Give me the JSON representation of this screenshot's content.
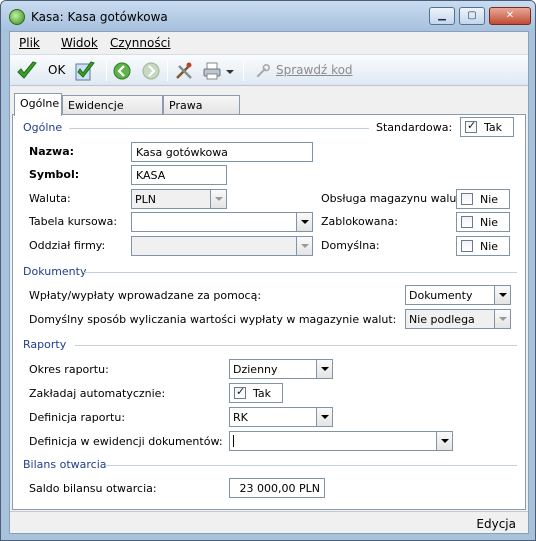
{
  "window": {
    "title": "Kasa: Kasa gotówkowa",
    "controls": {
      "minimize": "▁",
      "maximize": "▢",
      "close": "✕"
    }
  },
  "menu": {
    "items": [
      "Plik",
      "Widok",
      "Czynności"
    ]
  },
  "toolbar": {
    "ok_label": "OK",
    "check_label": "Sprawdź kod",
    "icons": [
      "ok-check-icon",
      "save-check-icon",
      "back-arrow-icon",
      "forward-arrow-icon",
      "tools-icon",
      "printer-icon",
      "dropdown-icon",
      "wrench-icon"
    ]
  },
  "tabs": [
    "Ogólne",
    "Ewidencje zależne",
    "Prawa danych"
  ],
  "general": {
    "section": "Ogólne",
    "standard_label": "Standardowa:",
    "standard_value": "Tak",
    "name_label": "Nazwa:",
    "name_value": "Kasa gotówkowa",
    "symbol_label": "Symbol:",
    "symbol_value": "KASA",
    "currency_label": "Waluta:",
    "currency_value": "PLN",
    "rate_table_label": "Tabela kursowa:",
    "rate_table_value": "",
    "branch_label": "Oddział firmy:",
    "branch_value": "",
    "currency_store_label": "Obsługa magazynu walut:",
    "currency_store_value": "Nie",
    "blocked_label": "Zablokowana:",
    "blocked_value": "Nie",
    "default_label": "Domyślna:",
    "default_value": "Nie"
  },
  "documents": {
    "section": "Dokumenty",
    "payments_label": "Wpłaty/wypłaty wprowadzane za pomocą:",
    "payments_value": "Dokumenty",
    "calc_label": "Domyślny sposób wyliczania wartości wypłaty w magazynie walut:",
    "calc_value": "Nie podlega"
  },
  "reports": {
    "section": "Raporty",
    "period_label": "Okres raportu:",
    "period_value": "Dzienny",
    "auto_label": "Zakładaj automatycznie:",
    "auto_value": "Tak",
    "def_label": "Definicja raportu:",
    "def_value": "RK",
    "def_evidence_label": "Definicja w ewidencji dokumentów:",
    "def_evidence_value": ""
  },
  "balance": {
    "section": "Bilans otwarcia",
    "saldo_label": "Saldo bilansu otwarcia:",
    "saldo_value": "23 000,00 PLN"
  },
  "status": {
    "mode": "Edycja"
  },
  "colors": {
    "section_title": "#1e3e8c",
    "titlebar_top": "#c9dcf0",
    "titlebar_bottom": "#a6c0dd",
    "check_green": "#3aa02a"
  }
}
